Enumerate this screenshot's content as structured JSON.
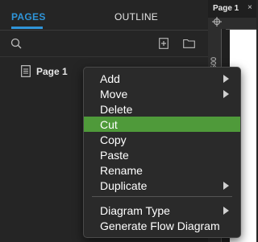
{
  "panel": {
    "tabs": [
      {
        "label": "PAGES",
        "active": true
      },
      {
        "label": "OUTLINE",
        "active": false
      }
    ],
    "toolbar_icons": [
      "search-icon",
      "add-page-icon",
      "folder-icon"
    ],
    "pages": [
      {
        "label": "Page 1",
        "icon": "page-icon"
      }
    ]
  },
  "canvas": {
    "tab_label": "Page 1",
    "close_label": "×",
    "ruler_number": "500"
  },
  "context_menu": {
    "items": [
      {
        "label": "Add",
        "has_submenu": true
      },
      {
        "label": "Move",
        "has_submenu": true
      },
      {
        "label": "Delete",
        "has_submenu": false
      },
      {
        "label": "Cut",
        "has_submenu": false,
        "highlighted": true
      },
      {
        "label": "Copy",
        "has_submenu": false
      },
      {
        "label": "Paste",
        "has_submenu": false
      },
      {
        "label": "Rename",
        "has_submenu": false
      },
      {
        "label": "Duplicate",
        "has_submenu": true
      },
      {
        "label": "Diagram Type",
        "has_submenu": true
      },
      {
        "label": "Generate Flow Diagram",
        "has_submenu": false
      }
    ]
  },
  "colors": {
    "accent": "#2f95d9",
    "highlight": "#4f9a3a",
    "panel_bg": "#252525",
    "menu_bg": "#2a2a2a"
  }
}
